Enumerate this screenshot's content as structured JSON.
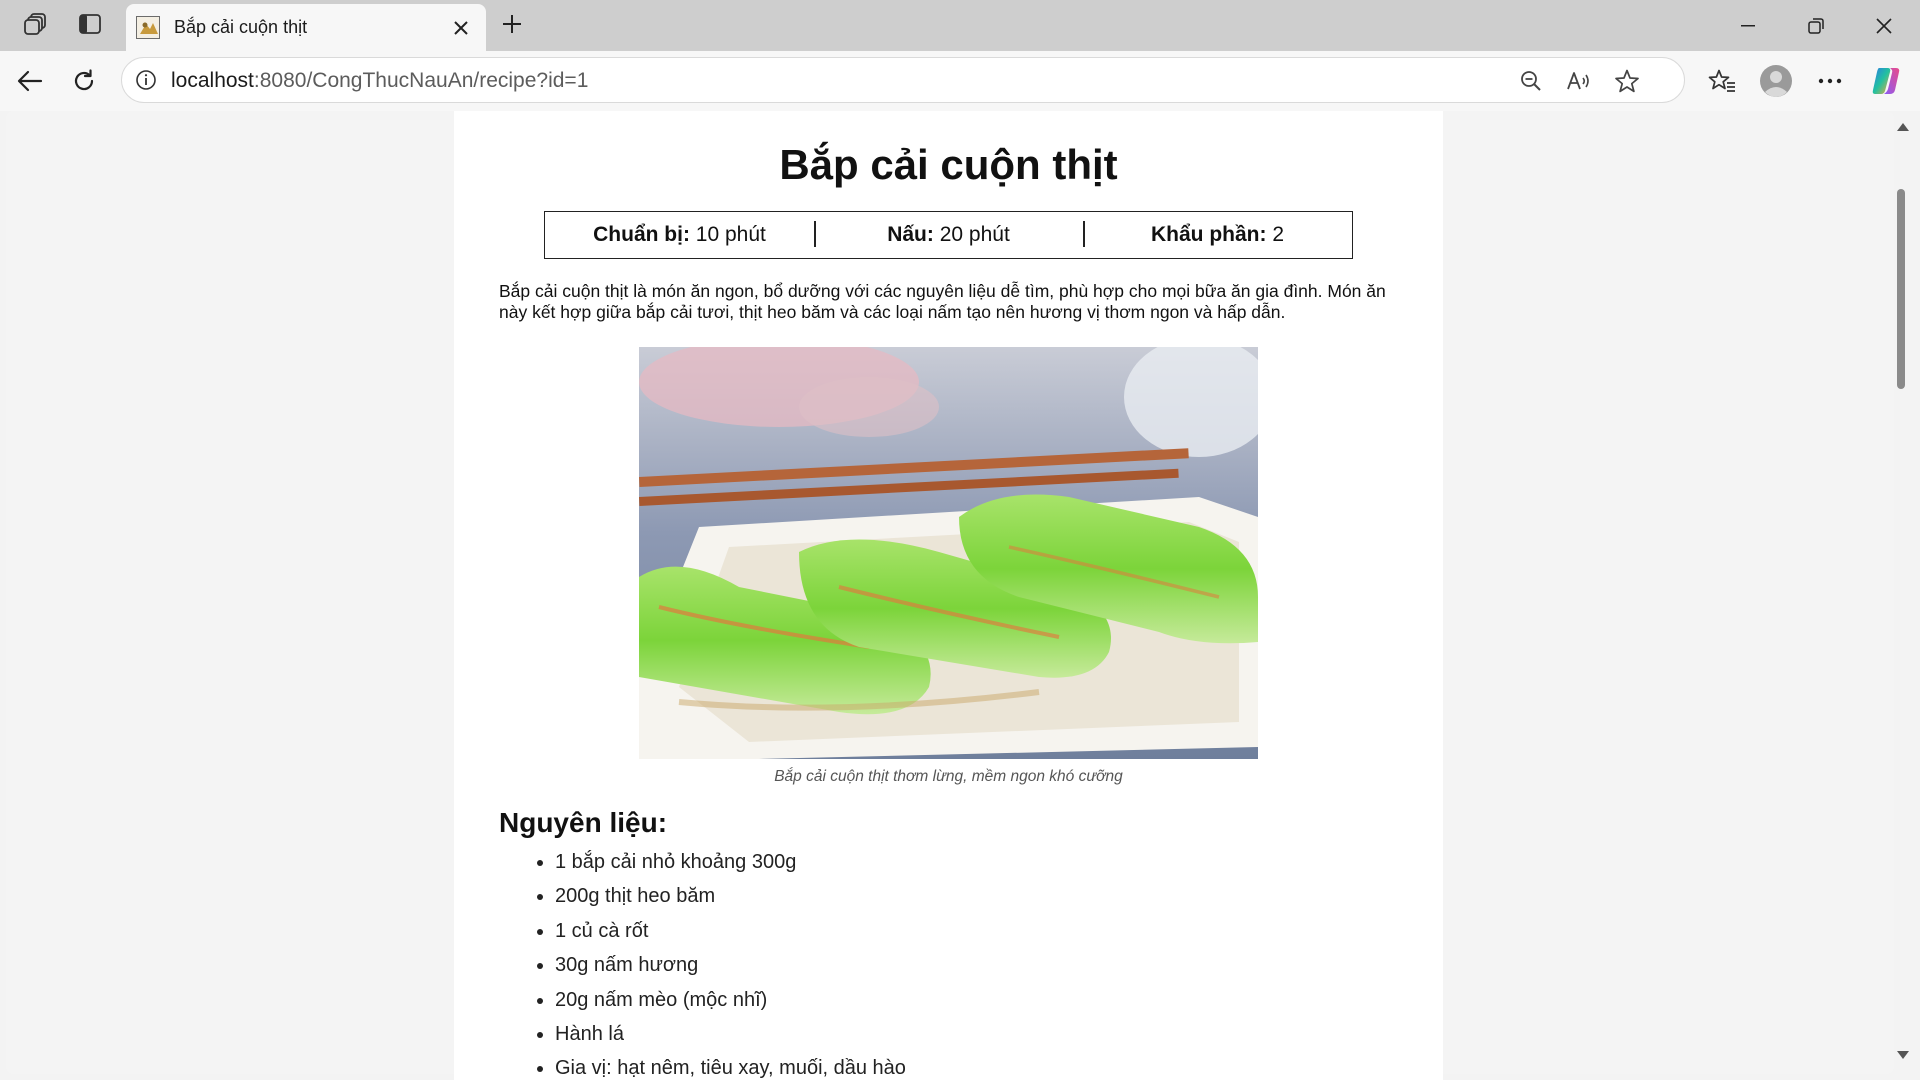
{
  "browser": {
    "tab_title": "Bắp cải cuộn thịt",
    "url_host": "localhost",
    "url_rest": ":8080/CongThucNauAn/recipe?id=1"
  },
  "recipe": {
    "title": "Bắp cải cuộn thịt",
    "meta": [
      {
        "label": "Chuẩn bị:",
        "value": " 10 phút"
      },
      {
        "label": "Nấu:",
        "value": " 20 phút"
      },
      {
        "label": "Khẩu phần:",
        "value": " 2"
      }
    ],
    "intro": "Bắp cải cuộn thịt là món ăn ngon, bổ dưỡng với các nguyên liệu dễ tìm, phù hợp cho mọi bữa ăn gia đình. Món ăn này kết hợp giữa bắp cải tươi, thịt heo băm và các loại nấm tạo nên hương vị thơm ngon và hấp dẫn.",
    "caption": "Bắp cải cuộn thịt thơm lừng, mềm ngon khó cưỡng",
    "ingredients_title": "Nguyên liệu:",
    "ingredients": [
      "1 bắp cải nhỏ khoảng 300g",
      "200g thịt heo băm",
      "1 củ cà rốt",
      "30g nấm hương",
      "20g nấm mèo (mộc nhĩ)",
      "Hành lá",
      "Gia vị: hạt nêm, tiêu xay, muối, dầu hào"
    ]
  },
  "icons": {
    "workspaces": "workspaces-icon",
    "tab_actions": "tab-actions-icon",
    "close_tab": "close-icon",
    "new_tab": "plus-icon",
    "back": "back-arrow-icon",
    "refresh": "refresh-icon",
    "site_info": "info-icon",
    "zoom": "zoom-out-icon",
    "read_aloud": "read-aloud-icon",
    "favorite": "star-icon",
    "favorites": "favorites-icon",
    "profile": "profile-icon",
    "more": "more-icon",
    "copilot": "copilot-icon"
  },
  "colors": {
    "titlebar": "#cecece",
    "page_background": "#ffffff",
    "viewport_background": "#f3f3f3"
  }
}
